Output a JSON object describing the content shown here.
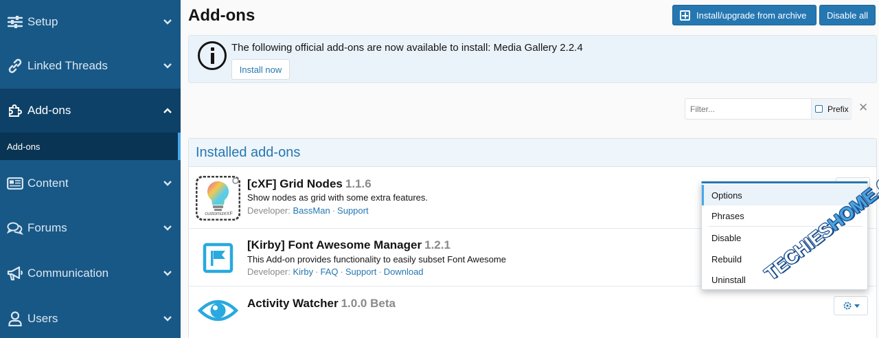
{
  "sidebar": {
    "items": [
      {
        "label": "Setup",
        "icon": "sliders-icon"
      },
      {
        "label": "Linked Threads",
        "icon": "link-icon"
      },
      {
        "label": "Add-ons",
        "icon": "puzzle-icon"
      },
      {
        "label": "Content",
        "icon": "newspaper-icon"
      },
      {
        "label": "Forums",
        "icon": "comments-icon"
      },
      {
        "label": "Communication",
        "icon": "megaphone-icon"
      },
      {
        "label": "Users",
        "icon": "user-icon"
      }
    ],
    "sub_item": "Add-ons"
  },
  "header": {
    "title": "Add-ons",
    "install_label": "Install/upgrade from archive",
    "disable_all_label": "Disable all"
  },
  "notice": {
    "message": "The following official add-ons are now available to install: Media Gallery 2.2.4",
    "button": "Install now"
  },
  "filter": {
    "placeholder": "Filter...",
    "prefix_label": "Prefix"
  },
  "installed": {
    "heading": "Installed add-ons",
    "addons": [
      {
        "title": "[cXF] Grid Nodes",
        "version": "1.1.6",
        "description": "Show nodes as grid with some extra features.",
        "developer_label": "Developer:",
        "links": [
          "BassMan",
          "Support"
        ],
        "logo_text": "customizeXF"
      },
      {
        "title": "[Kirby] Font Awesome Manager",
        "version": "1.2.1",
        "description": "This Add-on provides functionality to easily subset Font Awesome",
        "developer_label": "Developer:",
        "links": [
          "Kirby",
          "FAQ",
          "Support",
          "Download"
        ]
      },
      {
        "title": "Activity Watcher",
        "version": "1.0.0 Beta"
      }
    ]
  },
  "menu": {
    "items": [
      "Options",
      "Phrases",
      "Disable",
      "Rebuild",
      "Uninstall"
    ]
  },
  "watermark": {
    "part1": "TECHIES",
    "part2": "HOME",
    "part3": ".COM"
  },
  "colors": {
    "sidebar": "#185886",
    "accent": "#2577b1",
    "active": "#0e4167"
  }
}
